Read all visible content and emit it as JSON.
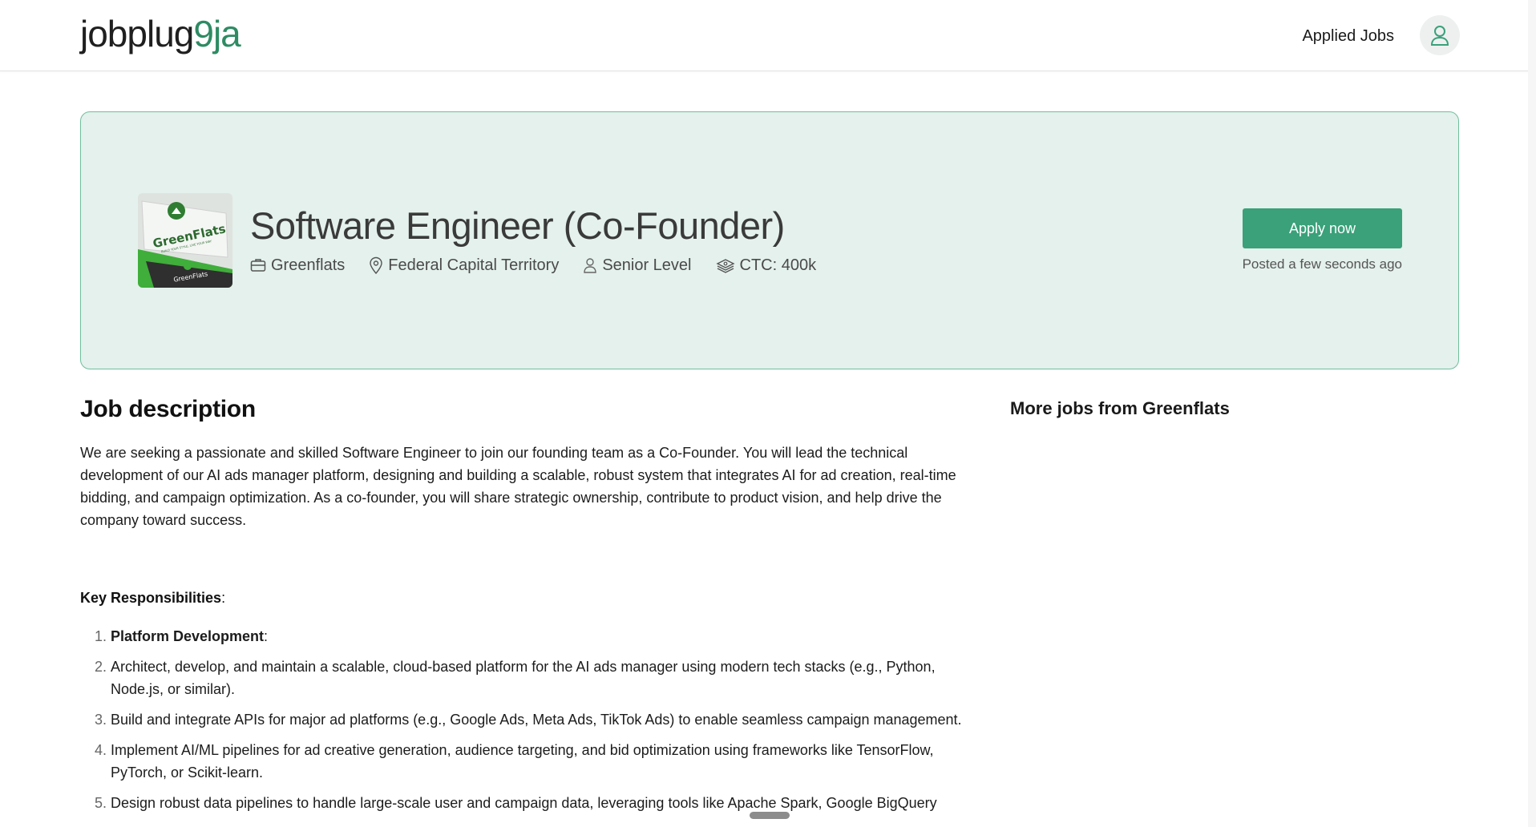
{
  "header": {
    "logo_main": "jobplug",
    "logo_accent": "9ja",
    "applied_jobs_label": "Applied Jobs",
    "avatar_icon": "user-icon"
  },
  "job": {
    "title": "Software Engineer (Co-Founder)",
    "company": "Greenflats",
    "location": "Federal Capital Territory",
    "level": "Senior Level",
    "ctc": "CTC: 400k",
    "apply_label": "Apply now",
    "posted": "Posted a few seconds ago",
    "logo_text": "GreenFlats",
    "logo_tagline": "BUILD YOUR STYLE, LIVE YOUR WAY"
  },
  "description": {
    "heading": "Job description",
    "intro": "We are seeking a passionate and skilled Software Engineer to join our founding team as a Co-Founder. You will lead the technical development of our AI ads manager platform, designing and building a scalable, robust system that integrates AI for ad creation, real-time bidding, and campaign optimization. As a co-founder, you will share strategic ownership, contribute to product vision, and help drive the company toward success.",
    "key_resp_label": "Key Responsibilities",
    "key_resp_suffix": ":",
    "items": [
      {
        "bold": "Platform Development",
        "text": ":"
      },
      {
        "bold": "",
        "text": "Architect, develop, and maintain a scalable, cloud-based platform for the AI ads manager using modern tech stacks (e.g., Python, Node.js, or similar)."
      },
      {
        "bold": "",
        "text": "Build and integrate APIs for major ad platforms (e.g., Google Ads, Meta Ads, TikTok Ads) to enable seamless campaign management."
      },
      {
        "bold": "",
        "text": "Implement AI/ML pipelines for ad creative generation, audience targeting, and bid optimization using frameworks like TensorFlow, PyTorch, or Scikit-learn."
      },
      {
        "bold": "",
        "text": "Design robust data pipelines to handle large-scale user and campaign data, leveraging tools like Apache Spark, Google BigQuery"
      }
    ]
  },
  "sidebar": {
    "more_jobs_title": "More jobs from Greenflats"
  },
  "colors": {
    "accent": "#2e8b63",
    "button": "#3aa17a",
    "hero_bg": "#e4f1ec",
    "hero_border": "#6fbf9c"
  }
}
